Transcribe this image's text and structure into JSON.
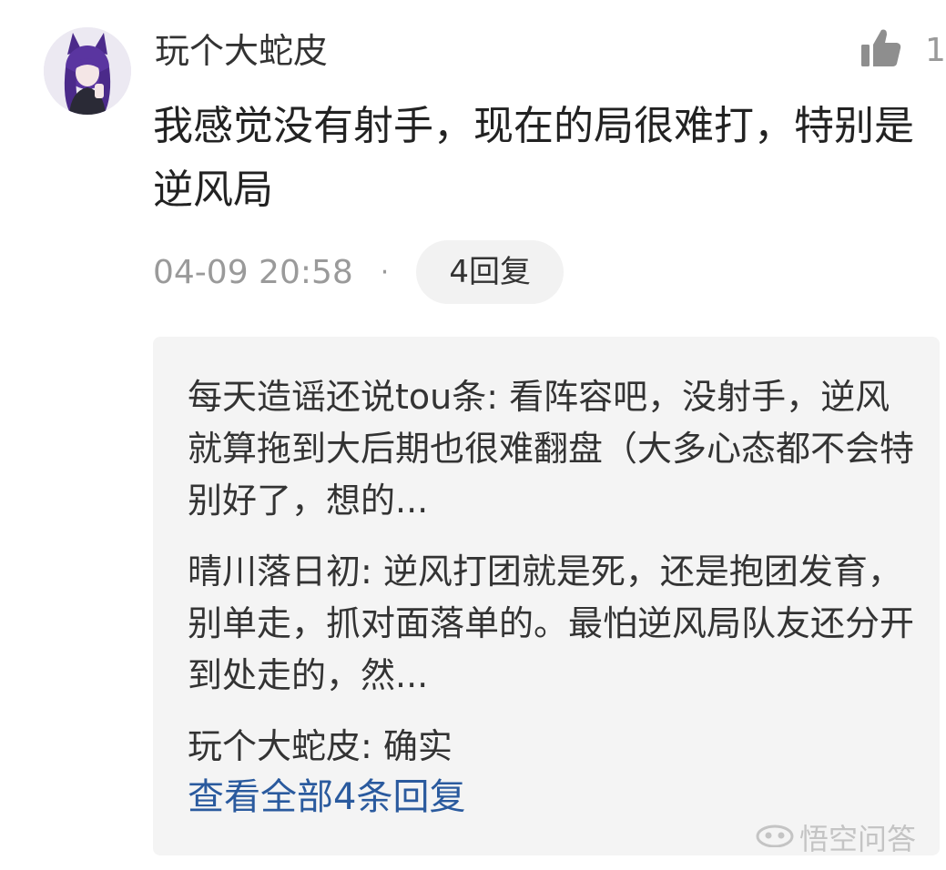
{
  "comment": {
    "username": "玩个大蛇皮",
    "like_count": "1",
    "text": "我感觉没有射手，现在的局很难打，特别是逆风局",
    "timestamp": "04-09 20:58",
    "separator": "·",
    "reply_count_label": "4回复"
  },
  "replies": [
    {
      "text": "每天造谣还说tou条: 看阵容吧，没射手，逆风就算拖到大后期也很难翻盘（大多心态都不会特别好了，想的..."
    },
    {
      "text": "晴川落日初: 逆风打团就是死，还是抱团发育，别单走，抓对面落单的。最怕逆风局队友还分开到处走的，然..."
    },
    {
      "text": "玩个大蛇皮: 确实"
    }
  ],
  "view_all_label": "查看全部4条回复",
  "watermark": {
    "text": "悟空问答",
    "icon": "eyes-logo-icon"
  },
  "icons": {
    "like": "thumbs-up-icon"
  },
  "colors": {
    "link": "#2a5a9e",
    "meta": "#9a9a9a",
    "reply_bg": "#f4f4f4",
    "avatar_hair": "#4b2a8a"
  }
}
